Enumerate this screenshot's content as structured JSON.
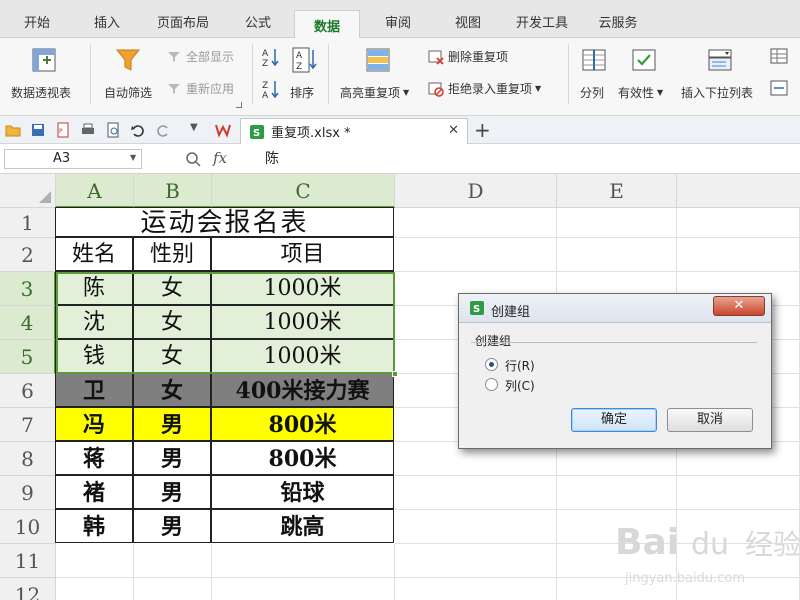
{
  "menu_tabs": [
    "开始",
    "插入",
    "页面布局",
    "公式",
    "数据",
    "审阅",
    "视图",
    "开发工具",
    "云服务"
  ],
  "active_tab": "数据",
  "ribbon": {
    "pivot_label": "数据透视表",
    "autofilter_label": "自动筛选",
    "show_all_label": "全部显示",
    "reapply_label": "重新应用",
    "sort_label": "排序",
    "highlight_dup_label": "高亮重复项",
    "remove_dup_label": "删除重复项",
    "reject_dup_label": "拒绝录入重复项",
    "split_label": "分列",
    "validity_label": "有效性",
    "insert_dropdown_label": "插入下拉列表"
  },
  "document_tab": "重复项.xlsx *",
  "formula_bar": {
    "name_box": "A3",
    "fx_label": "fx",
    "content": "陈"
  },
  "columns": [
    "A",
    "B",
    "C",
    "D",
    "E"
  ],
  "rows": [
    "1",
    "2",
    "3",
    "4",
    "5",
    "6",
    "7",
    "8",
    "9",
    "10",
    "11",
    "12"
  ],
  "sheet": {
    "title": "运动会报名表",
    "headers": [
      "姓名",
      "性别",
      "项目"
    ],
    "data": [
      [
        "陈",
        "女",
        "1000米"
      ],
      [
        "沈",
        "女",
        "1000米"
      ],
      [
        "钱",
        "女",
        "1000米"
      ],
      [
        "卫",
        "女",
        "400米接力赛"
      ],
      [
        "冯",
        "男",
        "800米"
      ],
      [
        "蒋",
        "男",
        "800米"
      ],
      [
        "褚",
        "男",
        "铅球"
      ],
      [
        "韩",
        "男",
        "跳高"
      ]
    ]
  },
  "colors": {
    "selection_fill": "#e2f0d9",
    "selection_border": "#5c9a3a",
    "gray_row": "#7f7f7f",
    "yellow_row": "#ffff00",
    "accent_green": "#1b7a2c"
  },
  "dialog": {
    "title": "创建组",
    "group_label": "创建组",
    "option_row": "行(R)",
    "option_col": "列(C)",
    "selected": "行(R)",
    "ok_label": "确定",
    "cancel_label": "取消",
    "close_glyph": "✕"
  }
}
